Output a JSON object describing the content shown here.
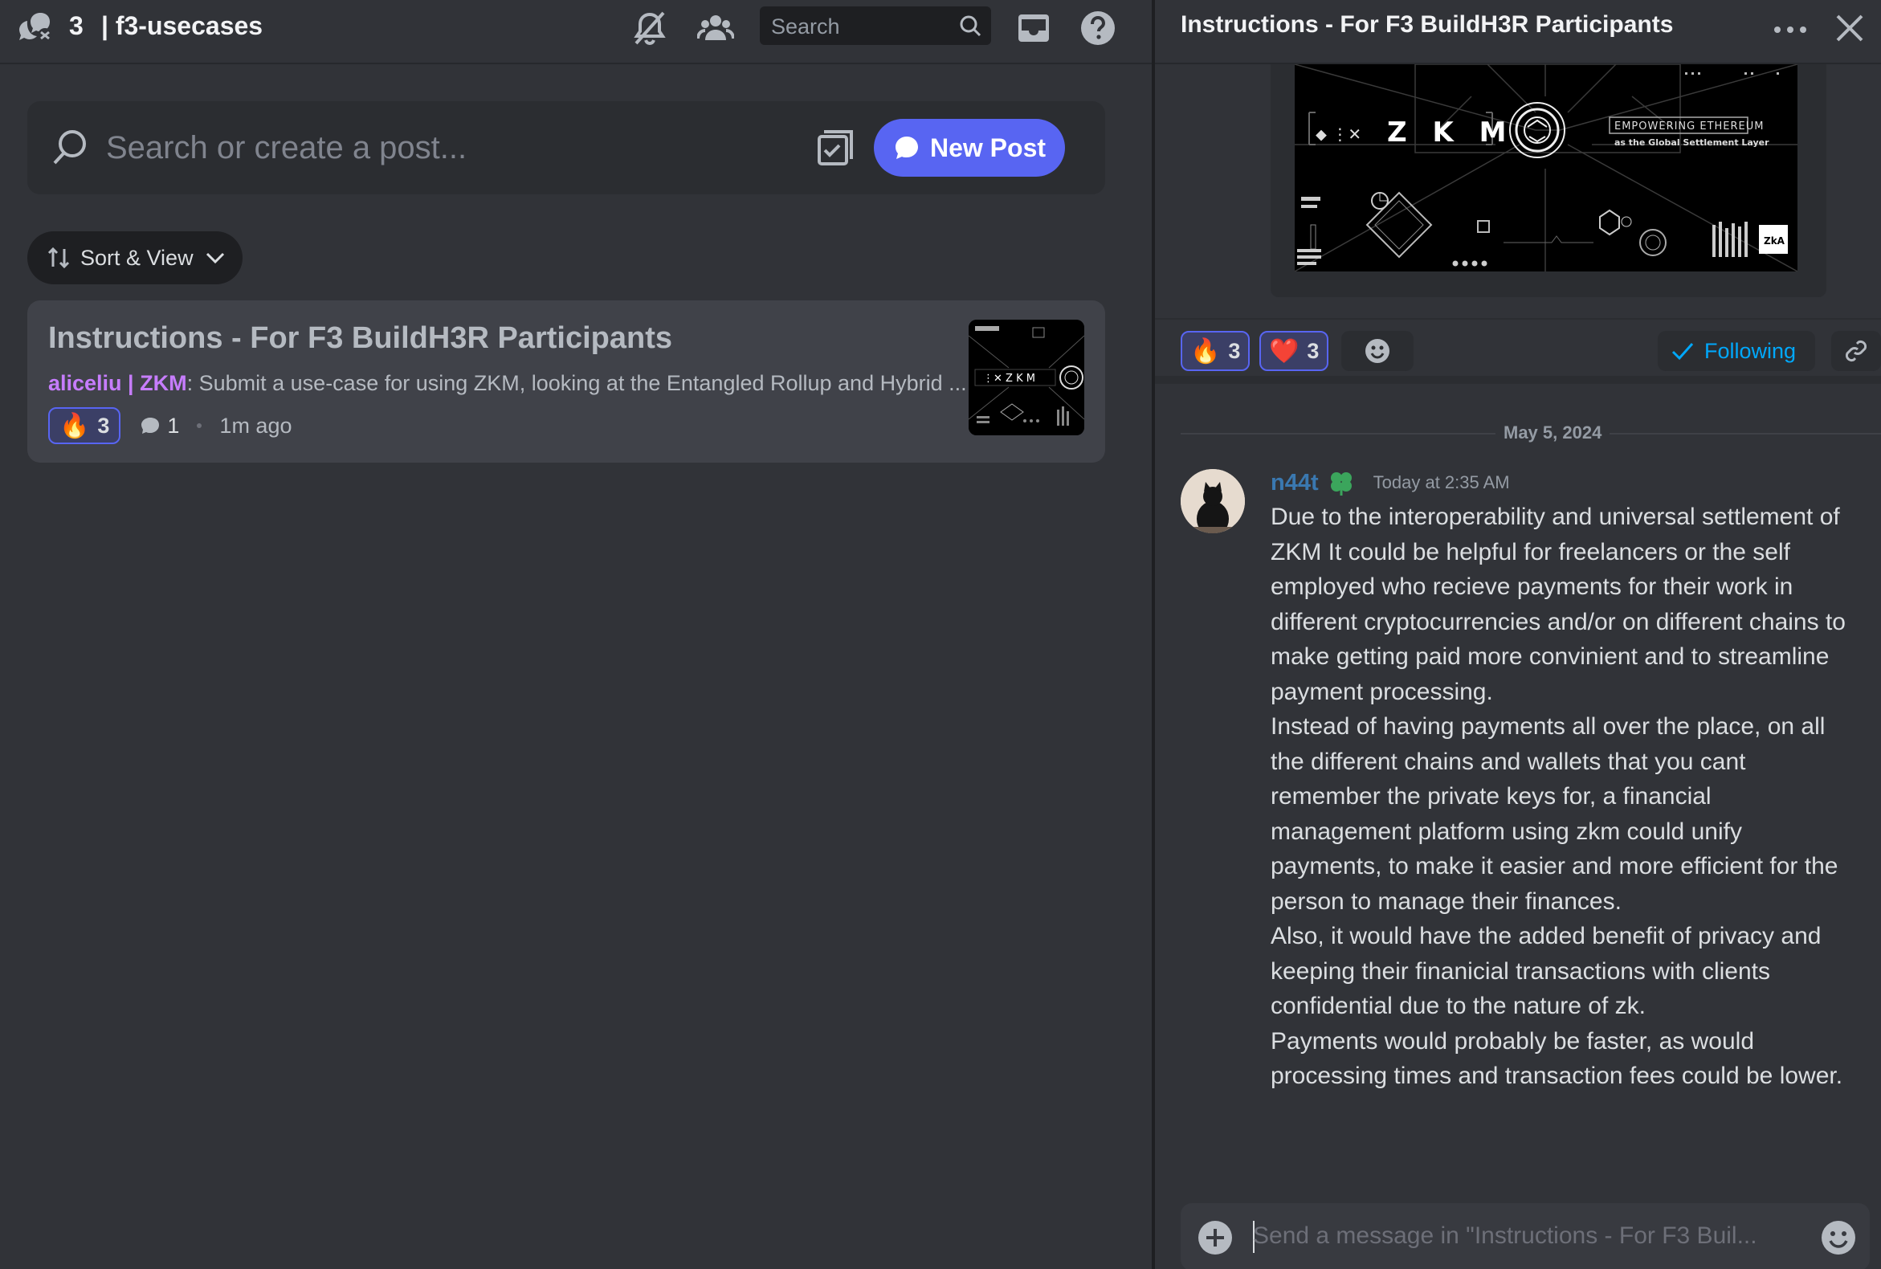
{
  "channel": {
    "count": "3",
    "separator": "|",
    "name": "f3-usecases"
  },
  "topbar": {
    "search_placeholder": "Search",
    "icons": [
      "forum-channel-icon",
      "mute-notifications-icon",
      "members-icon",
      "search-icon",
      "inbox-icon",
      "help-icon"
    ]
  },
  "post_search": {
    "placeholder": "Search or create a post...",
    "new_post_label": "New Post"
  },
  "sort_view": {
    "label": "Sort & View"
  },
  "posts": [
    {
      "title": "Instructions - For F3 BuildH3R Participants",
      "author": "aliceliu | ZKM",
      "author_suffix": ":",
      "preview": " Submit a use-case for using ZKM, looking at the Entangled Rollup and Hybrid ...",
      "reaction_emoji": "🔥",
      "reaction_count": "3",
      "message_count": "1",
      "time": "1m ago"
    }
  ],
  "thread": {
    "title": "Instructions - For F3 BuildH3R Participants",
    "banner": {
      "logo_text": "Z K M",
      "tagline_1": "EMPOWERING ETHEREUM",
      "tagline_2": "as the Global Settlement Layer",
      "corner": "ZkA"
    },
    "reactions": [
      {
        "emoji": "🔥",
        "count": "3"
      },
      {
        "emoji": "❤️",
        "count": "3"
      }
    ],
    "following_label": "Following",
    "date_divider": "May 5, 2024",
    "message": {
      "username": "n44t",
      "timestamp": "Today at 2:35 AM",
      "paragraphs": [
        "Due to the interoperability and universal settlement of ZKM It could be helpful for freelancers or the self employed who recieve payments for their work in different cryptocurrencies and/or on different chains to make getting paid more convinient and to streamline payment processing.",
        "Instead of having payments all over the place, on all the different chains and wallets that you cant remember the private keys for, a financial management platform using zkm could unify payments, to make it easier and more efficient for the person to manage their finances.",
        "Also, it would have the added benefit of privacy and keeping their finanicial transactions with clients confidential due to the nature of zk.",
        "Payments would probably be faster, as would processing times and transaction fees could be lower."
      ]
    },
    "composer_placeholder": "Send a message in \"Instructions - For F3 Buil..."
  },
  "colors": {
    "background": "#313338",
    "sidebar_dark": "#1e1f22",
    "card": "#404249",
    "accent": "#5865f2",
    "author_purple": "#c77dff",
    "following_blue": "#00a8fc",
    "username_blue": "#3a78b0"
  }
}
